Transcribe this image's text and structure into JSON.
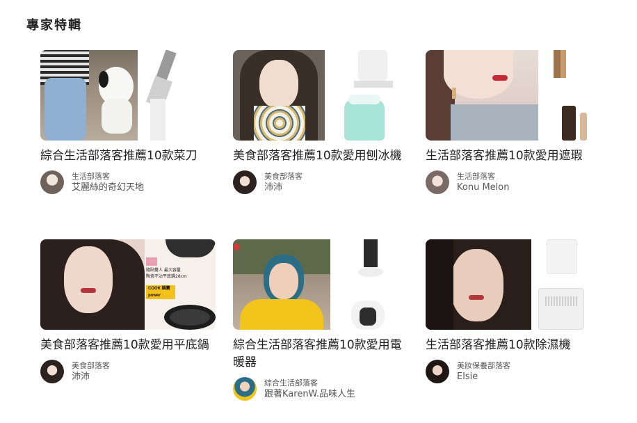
{
  "section": {
    "title": "專家特輯"
  },
  "cards": [
    {
      "title": "綜合生活部落客推薦10款菜刀",
      "role": "生活部落客",
      "name": "艾麗絲的奇幻天地"
    },
    {
      "title": "美食部落客推薦10款愛用刨冰機",
      "role": "美食部落客",
      "name": "沛沛"
    },
    {
      "title": "生活部落客推薦10款愛用遮瑕",
      "role": "生活部落客",
      "name": "Konu Melon"
    },
    {
      "title": "美食部落客推薦10款愛用平底鍋",
      "role": "美食部落客",
      "name": "沛沛"
    },
    {
      "title": "綜合生活部落客推薦10款愛用電暖器",
      "role": "綜合生活部落客",
      "name": "跟著KarenW.品味人生"
    },
    {
      "title": "生活部落客推薦10款除濕機",
      "role": "美妝保養部落客",
      "name": "Elsie"
    }
  ],
  "card4_promo": {
    "line1": "隨貼雙人 最大容量",
    "line2": "陶瓷不沾平底鍋28cm",
    "brand1": "COOK",
    "brand2": "power",
    "brand3": "鍋寶"
  },
  "colors": {
    "title": "#222222",
    "meta": "#555555",
    "promo_yellow": "#f2c21b"
  }
}
